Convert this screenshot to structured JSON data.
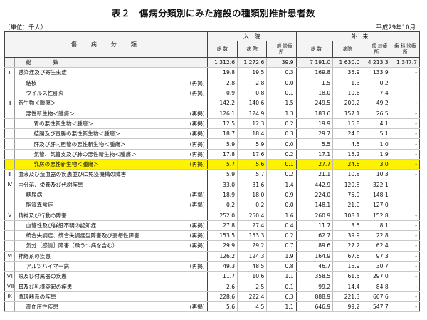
{
  "title": "表２　傷病分類別にみた施設の種類別推計患者数",
  "unit": "（単位：千人）",
  "date": "平成29年10月",
  "header": {
    "category": "傷　病　分　類",
    "inpatient": "入　院",
    "outpatient": "外　来",
    "cols": [
      "総 数",
      "病 院",
      "一 般 診療所",
      "総 数",
      "病院",
      "一 般 診療所",
      "歯 科 診療所"
    ]
  },
  "rows": [
    {
      "rn": "",
      "name": "総　　　　数",
      "indent": 1,
      "tag": "",
      "v": [
        "1 312.6",
        "1 272.6",
        "39.9",
        "7 191.0",
        "1 630.0",
        "4 213.3",
        "1 347.7"
      ],
      "total": true
    },
    {
      "rn": "Ⅰ",
      "name": "感染症及び寄生虫症",
      "indent": 0,
      "tag": "",
      "v": [
        "19.8",
        "19.5",
        "0.3",
        "169.8",
        "35.9",
        "133.9",
        "-"
      ]
    },
    {
      "rn": "",
      "name": "結核",
      "indent": 1,
      "tag": "(再掲)",
      "v": [
        "2.8",
        "2.8",
        "0.0",
        "1.5",
        "1.3",
        "0.2",
        "-"
      ]
    },
    {
      "rn": "",
      "name": "ウイルス性肝炎",
      "indent": 1,
      "tag": "(再掲)",
      "v": [
        "0.9",
        "0.8",
        "0.1",
        "18.0",
        "10.6",
        "7.4",
        "-"
      ]
    },
    {
      "rn": "Ⅱ",
      "name": "新生物＜腫瘍＞",
      "indent": 0,
      "tag": "",
      "v": [
        "142.2",
        "140.6",
        "1.5",
        "249.5",
        "200.2",
        "49.2",
        "-"
      ]
    },
    {
      "rn": "",
      "name": "悪性新生物＜腫瘍＞",
      "indent": 1,
      "tag": "(再掲)",
      "v": [
        "126.1",
        "124.9",
        "1.3",
        "183.6",
        "157.1",
        "26.5",
        "-"
      ]
    },
    {
      "rn": "",
      "name": "胃の悪性新生物＜腫瘍＞",
      "indent": 2,
      "tag": "(再掲)",
      "v": [
        "12.5",
        "12.3",
        "0.2",
        "19.9",
        "15.8",
        "4.1",
        "-"
      ]
    },
    {
      "rn": "",
      "name": "結腸及び直腸の悪性新生物＜腫瘍＞",
      "indent": 2,
      "tag": "(再掲)",
      "v": [
        "18.7",
        "18.4",
        "0.3",
        "29.7",
        "24.6",
        "5.1",
        "-"
      ]
    },
    {
      "rn": "",
      "name": "肝及び肝内胆管の悪性新生物＜腫瘍＞",
      "indent": 2,
      "tag": "(再掲)",
      "v": [
        "5.9",
        "5.9",
        "0.0",
        "5.5",
        "4.5",
        "1.0",
        "-"
      ]
    },
    {
      "rn": "",
      "name": "気管、気管支及び肺の悪性新生物＜腫瘍＞",
      "indent": 2,
      "tag": "(再掲)",
      "v": [
        "17.8",
        "17.6",
        "0.2",
        "17.1",
        "15.2",
        "1.9",
        "-"
      ]
    },
    {
      "rn": "",
      "name": "乳房の悪性新生物＜腫瘍＞",
      "indent": 2,
      "tag": "(再掲)",
      "v": [
        "5.7",
        "5.6",
        "0.1",
        "27.7",
        "24.6",
        "3.0",
        "-"
      ],
      "highlight": true
    },
    {
      "rn": "Ⅲ",
      "name": "血液及び造血器の疾患並びに免疫機構の障害",
      "indent": 0,
      "tag": "",
      "v": [
        "5.9",
        "5.7",
        "0.2",
        "21.1",
        "10.8",
        "10.3",
        "-"
      ]
    },
    {
      "rn": "Ⅳ",
      "name": "内分泌、栄養及び代謝疾患",
      "indent": 0,
      "tag": "",
      "v": [
        "33.0",
        "31.6",
        "1.4",
        "442.9",
        "120.8",
        "322.1",
        "-"
      ]
    },
    {
      "rn": "",
      "name": "糖尿病",
      "indent": 1,
      "tag": "(再掲)",
      "v": [
        "18.9",
        "18.0",
        "0.9",
        "224.0",
        "75.9",
        "148.1",
        "-"
      ]
    },
    {
      "rn": "",
      "name": "脂質異常症",
      "indent": 1,
      "tag": "(再掲)",
      "v": [
        "0.2",
        "0.2",
        "0.0",
        "148.1",
        "21.0",
        "127.0",
        "-"
      ]
    },
    {
      "rn": "Ⅴ",
      "name": "精神及び行動の障害",
      "indent": 0,
      "tag": "",
      "v": [
        "252.0",
        "250.4",
        "1.6",
        "260.9",
        "108.1",
        "152.8",
        "-"
      ]
    },
    {
      "rn": "",
      "name": "血管性及び詳細不明の認知症",
      "indent": 1,
      "tag": "(再掲)",
      "v": [
        "27.8",
        "27.4",
        "0.4",
        "11.7",
        "3.5",
        "8.1",
        "-"
      ]
    },
    {
      "rn": "",
      "name": "統合失調症、統合失調症型障害及び妄想性障害",
      "indent": 1,
      "tag": "(再掲)",
      "v": [
        "153.5",
        "153.3",
        "0.2",
        "62.7",
        "39.9",
        "22.8",
        "-"
      ]
    },
    {
      "rn": "",
      "name": "気分［感情］障害（躁うつ病を含む）",
      "indent": 1,
      "tag": "(再掲)",
      "v": [
        "29.9",
        "29.2",
        "0.7",
        "89.6",
        "27.2",
        "62.4",
        "-"
      ]
    },
    {
      "rn": "Ⅵ",
      "name": "神経系の疾患",
      "indent": 0,
      "tag": "",
      "v": [
        "126.2",
        "124.3",
        "1.9",
        "164.9",
        "67.6",
        "97.3",
        "-"
      ]
    },
    {
      "rn": "",
      "name": "アルツハイマー病",
      "indent": 1,
      "tag": "(再掲)",
      "v": [
        "49.3",
        "48.5",
        "0.8",
        "46.7",
        "15.9",
        "30.7",
        "-"
      ]
    },
    {
      "rn": "Ⅶ",
      "name": "眼及び付属器の疾患",
      "indent": 0,
      "tag": "",
      "v": [
        "11.7",
        "10.6",
        "1.1",
        "358.5",
        "61.5",
        "297.0",
        "-"
      ]
    },
    {
      "rn": "Ⅷ",
      "name": "耳及び乳様突起の疾患",
      "indent": 0,
      "tag": "",
      "v": [
        "2.6",
        "2.5",
        "0.1",
        "99.2",
        "14.4",
        "84.8",
        "-"
      ]
    },
    {
      "rn": "Ⅸ",
      "name": "循環器系の疾患",
      "indent": 0,
      "tag": "",
      "v": [
        "228.6",
        "222.4",
        "6.3",
        "888.9",
        "221.3",
        "667.6",
        "-"
      ]
    },
    {
      "rn": "",
      "name": "高血圧性疾患",
      "indent": 1,
      "tag": "(再掲)",
      "v": [
        "5.6",
        "4.5",
        "1.1",
        "646.9",
        "99.2",
        "547.7",
        "-"
      ]
    }
  ]
}
